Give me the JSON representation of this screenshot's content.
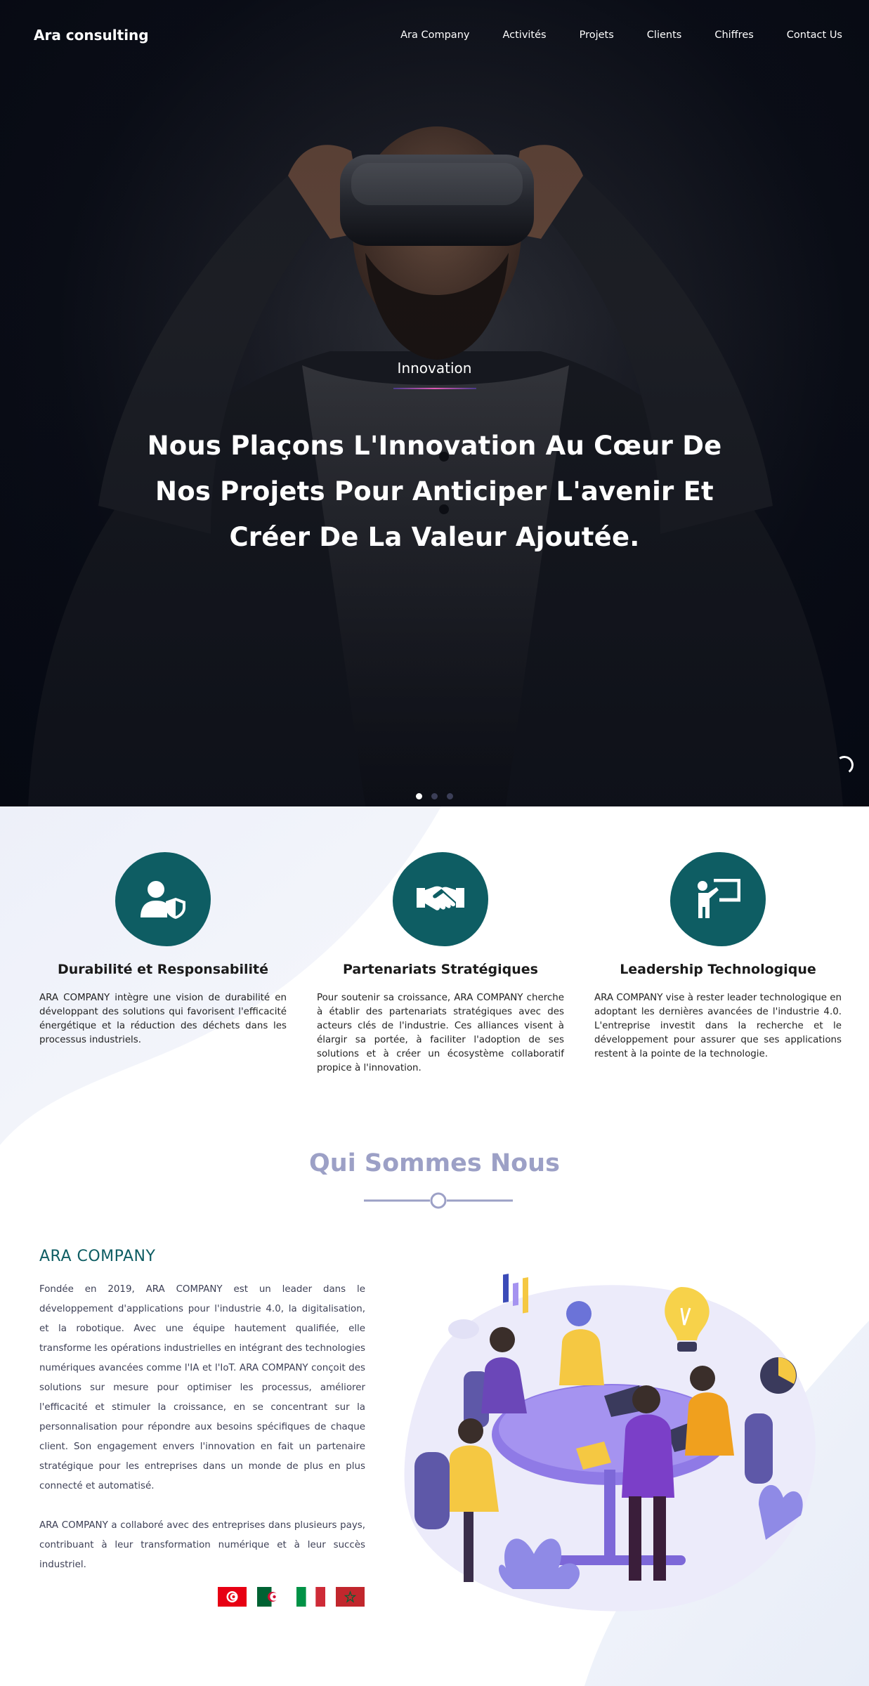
{
  "navbar": {
    "brand": "Ara consulting",
    "links": [
      "Ara Company",
      "Activités",
      "Projets",
      "Clients",
      "Chiffres",
      "Contact Us"
    ]
  },
  "hero": {
    "kicker": "Innovation",
    "title": "Nous Plaçons L'Innovation Au Cœur De Nos Projets Pour Anticiper L'avenir Et Créer De La Valeur Ajoutée.",
    "slide_count": 3,
    "active_slide": 1
  },
  "features": [
    {
      "icon": "user-shield-icon",
      "title": "Durabilité et Responsabilité",
      "text": "ARA COMPANY intègre une vision de durabilité en développant des solutions qui favorisent l'efficacité énergétique et la réduction des déchets dans les processus industriels."
    },
    {
      "icon": "handshake-icon",
      "title": "Partenariats Stratégiques",
      "text": "Pour soutenir sa croissance, ARA COMPANY cherche à établir des partenariats stratégiques avec des acteurs clés de l'industrie. Ces alliances visent à élargir sa portée, à faciliter l'adoption de ses solutions et à créer un écosystème collaboratif propice à l'innovation."
    },
    {
      "icon": "presenter-icon",
      "title": "Leadership Technologique",
      "text": "ARA COMPANY vise à rester leader technologique en adoptant les dernières avancées de l'industrie 4.0. L'entreprise investit dans la recherche et le développement pour assurer que ses applications restent à la pointe de la technologie."
    }
  ],
  "about": {
    "section_title": "Qui Sommes Nous",
    "company": "ARA COMPANY",
    "paragraph1": "Fondée en 2019, ARA COMPANY est un leader dans le développement d'applications pour l'industrie 4.0, la digitalisation, et la robotique. Avec une équipe hautement qualifiée, elle transforme les opérations industrielles en intégrant des technologies numériques avancées comme l'IA et l'IoT. ARA COMPANY conçoit des solutions sur mesure pour optimiser les processus, améliorer l'efficacité et stimuler la croissance, en se concentrant sur la personnalisation pour répondre aux besoins spécifiques de chaque client. Son engagement envers l'innovation en fait un partenaire stratégique pour les entreprises dans un monde de plus en plus connecté et automatisé.",
    "paragraph2": "ARA COMPANY a collaboré avec des entreprises dans plusieurs pays, contribuant à leur transformation numérique et à leur succès industriel.",
    "flags": [
      "tunisia-flag-icon",
      "algeria-flag-icon",
      "italy-flag-icon",
      "morocco-flag-icon"
    ]
  },
  "colors": {
    "accent": "#0e5d63",
    "hero_bg": "#0b0e17",
    "section_title": "#9ca0c6",
    "body_text": "#3c3f55"
  }
}
